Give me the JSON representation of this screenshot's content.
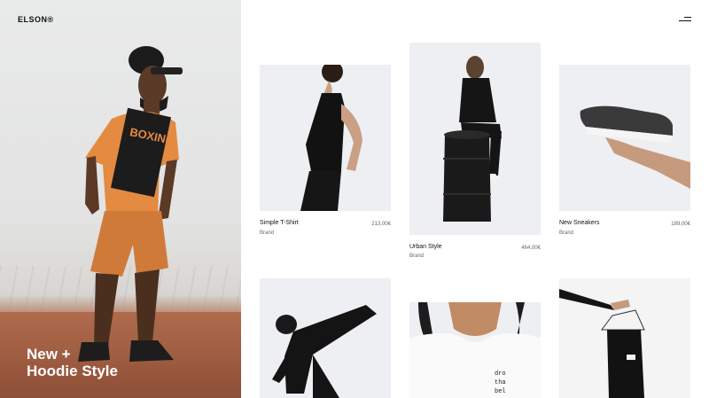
{
  "brand": {
    "name": "ELSON®"
  },
  "hero": {
    "title_line1": "New +",
    "title_line2": "Hoodie Style"
  },
  "products": [
    {
      "name": "Simple T-Shirt",
      "brand": "Brand",
      "price": "213,00€"
    },
    {
      "name": "Urban Style",
      "brand": "Brand",
      "price": "464,00€"
    },
    {
      "name": "New Sneakers",
      "brand": "Brand",
      "price": "189,00€"
    }
  ],
  "colors": {
    "accent": "#111111",
    "card_bg": "#eeeff3",
    "tee_orange": "#e48a41"
  },
  "icons": {
    "menu": "hamburger-menu-icon"
  }
}
